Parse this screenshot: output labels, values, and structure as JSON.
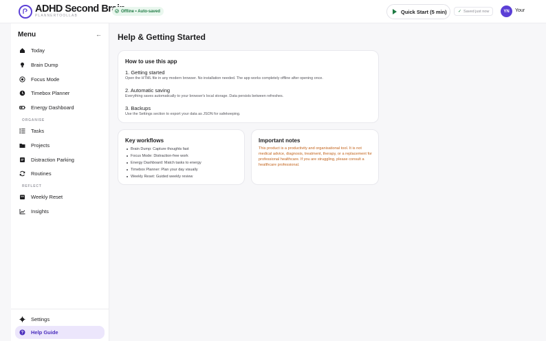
{
  "header": {
    "app_title": "ADHD Second Brain",
    "app_subtitle": "PLANNERTOOLLAB",
    "offline_badge": "Offline • Auto-saved",
    "quick_start_label": "Quick Start (5 min)",
    "saved_status": "Saved just now",
    "avatar_initials": "YN",
    "user_name": "Your"
  },
  "sidebar": {
    "menu_title": "Menu",
    "collapse_icon": "arrow-left-icon",
    "items": [
      {
        "label": "Today",
        "icon": "home-icon"
      },
      {
        "label": "Brain Dump",
        "icon": "lightbulb-icon"
      },
      {
        "label": "Focus Mode",
        "icon": "target-icon"
      },
      {
        "label": "Timebox Planner",
        "icon": "clock-icon"
      },
      {
        "label": "Energy Dashboard",
        "icon": "battery-icon"
      }
    ],
    "section_organise": "ORGANISE",
    "organise_items": [
      {
        "label": "Tasks",
        "icon": "list-icon"
      },
      {
        "label": "Projects",
        "icon": "folder-icon"
      },
      {
        "label": "Distraction Parking",
        "icon": "note-icon"
      },
      {
        "label": "Routines",
        "icon": "refresh-icon"
      }
    ],
    "section_reflect": "REFLECT",
    "reflect_items": [
      {
        "label": "Weekly Reset",
        "icon": "calendar-icon"
      },
      {
        "label": "Insights",
        "icon": "chart-icon"
      }
    ],
    "footer_items": [
      {
        "label": "Settings",
        "icon": "gear-icon"
      },
      {
        "label": "Help Guide",
        "icon": "help-icon",
        "active": true
      }
    ]
  },
  "main": {
    "page_title": "Help & Getting Started",
    "how_to": {
      "heading": "How to use this app",
      "steps": [
        {
          "title": "1. Getting started",
          "desc": "Open the HTML file in any modern browser. No installation needed. The app works completely offline after opening once."
        },
        {
          "title": "2. Automatic saving",
          "desc": "Everything saves automatically to your browser's local storage. Data persists between refreshes."
        },
        {
          "title": "3. Backups",
          "desc": "Use the Settings section to export your data as JSON for safekeeping."
        }
      ]
    },
    "workflows": {
      "heading": "Key workflows",
      "items": [
        "Brain Dump: Capture thoughts fast",
        "Focus Mode: Distraction-free work",
        "Energy Dashboard: Match tasks to energy",
        "Timebox Planner: Plan your day visually",
        "Weekly Reset: Guided weekly review"
      ]
    },
    "notes": {
      "heading": "Important notes",
      "text": "This product is a productivity and organisational tool. It is not medical advice, diagnosis, treatment, therapy, or a replacement for professional healthcare. If you are struggling, please consult a healthcare professional."
    }
  },
  "colors": {
    "brand": "#5b3fd6",
    "active_bg": "#ece6fc",
    "success": "#1e7a43",
    "warning_text": "#c2621a"
  }
}
